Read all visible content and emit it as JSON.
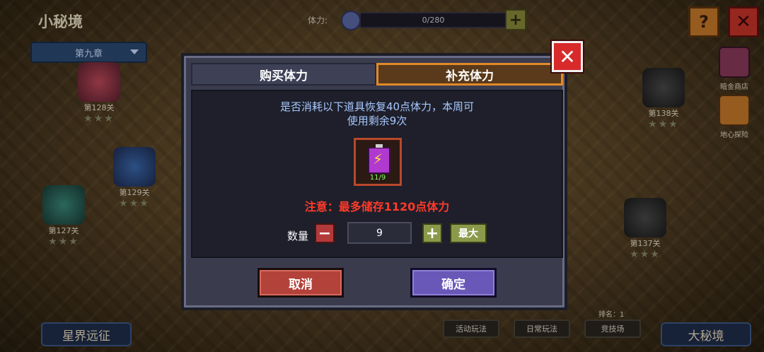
{
  "header": {
    "title": "小秘境",
    "chapter": "第九章",
    "stamina_label": "体力:",
    "stamina_value": "0/280",
    "plus_label": "+",
    "help_label": "?",
    "close_label": "✕"
  },
  "map": {
    "nodes": [
      {
        "label": "第128关",
        "stars": "★★★"
      },
      {
        "label": "第129关",
        "stars": "★★★"
      },
      {
        "label": "第127关",
        "stars": "★★★"
      },
      {
        "label": "第138关",
        "stars": "★★★"
      },
      {
        "label": "第137关",
        "stars": "★★★"
      }
    ]
  },
  "side": {
    "shop": "暗金商店",
    "explore": "地心探险"
  },
  "bottom": {
    "expedition": "星界远征",
    "activity": "活动玩法",
    "daily": "日常玩法",
    "rank": "排名：1",
    "arena": "竞技场",
    "big_realm": "大秘境"
  },
  "dialog": {
    "tab_buy": "购买体力",
    "tab_refill": "补充体力",
    "message_line1": "是否消耗以下道具恢复40点体力，本周可",
    "message_line2": "使用剩余9次",
    "item_count": "11/9",
    "warning": "注意：最多储存1120点体力",
    "quantity_label": "数量",
    "minus_label": "−",
    "quantity_value": "9",
    "plus_label": "+",
    "max_label": "最大",
    "cancel_label": "取消",
    "confirm_label": "确定",
    "close_label": "✕"
  }
}
